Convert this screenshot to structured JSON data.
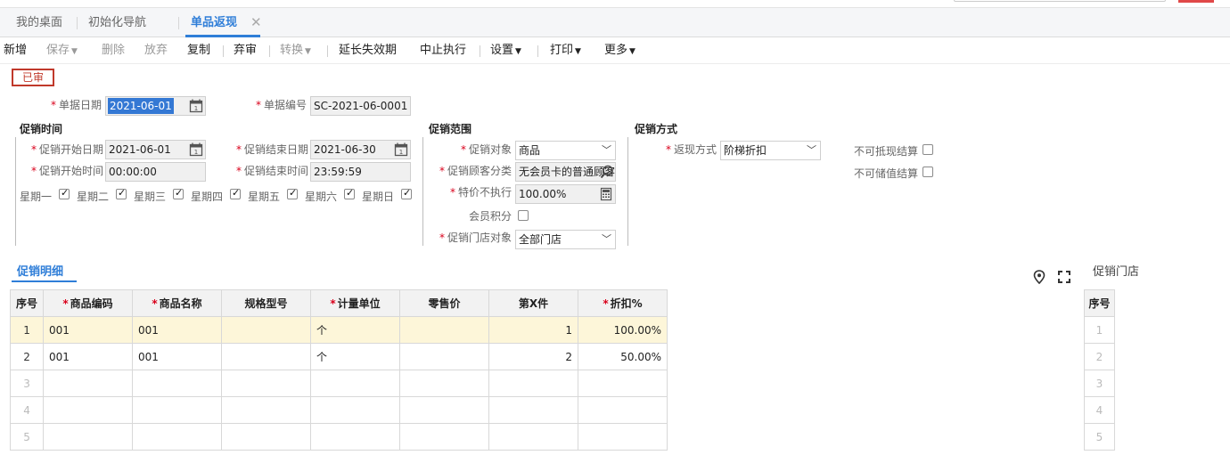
{
  "tabs": [
    {
      "label": "我的桌面"
    },
    {
      "label": "初始化导航"
    },
    {
      "label": "单品返现",
      "active": true
    }
  ],
  "tab_close_icon": "close-icon",
  "toolbar": {
    "new": "新增",
    "save": "保存",
    "delete": "删除",
    "discard": "放弃",
    "copy": "复制",
    "unaudit": "弃审",
    "convert": "转换",
    "extend": "延长失效期",
    "stop": "中止执行",
    "settings": "设置",
    "print": "打印",
    "more": "更多"
  },
  "status_stamp": "已审",
  "form": {
    "doc_date_label": "单据日期",
    "doc_date": "2021-06-01",
    "doc_no_label": "单据编号",
    "doc_no": "SC-2021-06-0001",
    "time_section": "促销时间",
    "start_date_label": "促销开始日期",
    "start_date": "2021-06-01",
    "end_date_label": "促销结束日期",
    "end_date": "2021-06-30",
    "start_time_label": "促销开始时间",
    "start_time": "00:00:00",
    "end_time_label": "促销结束时间",
    "end_time": "23:59:59",
    "weekdays": [
      {
        "label": "星期一",
        "checked": true
      },
      {
        "label": "星期二",
        "checked": true
      },
      {
        "label": "星期三",
        "checked": true
      },
      {
        "label": "星期四",
        "checked": true
      },
      {
        "label": "星期五",
        "checked": true
      },
      {
        "label": "星期六",
        "checked": true
      },
      {
        "label": "星期日",
        "checked": true
      }
    ],
    "scope_section": "促销范围",
    "target_label": "促销对象",
    "target_value": "商品",
    "customer_class_label": "促销顾客分类",
    "customer_class_value": "无会员卡的普通顾客",
    "special_price_label": "特价不执行",
    "special_price_value": "100.00%",
    "member_points_label": "会员积分",
    "member_points_checked": false,
    "store_target_label": "促销门店对象",
    "store_target_value": "全部门店",
    "method_section": "促销方式",
    "cashback_label": "返现方式",
    "cashback_value": "阶梯折扣",
    "no_offset_label": "不可抵现结算",
    "no_offset_checked": false,
    "no_stored_label": "不可储值结算",
    "no_stored_checked": false
  },
  "detail": {
    "tab_label": "促销明细",
    "columns": [
      "序号",
      "商品编码",
      "商品名称",
      "规格型号",
      "计量单位",
      "零售价",
      "第X件",
      "折扣%"
    ],
    "required_columns": [
      1,
      2,
      4,
      7
    ],
    "rows": [
      {
        "no": "1",
        "code": "001",
        "name": "001",
        "spec": "",
        "unit": "个",
        "price": "",
        "nth": "1",
        "discount": "100.00%"
      },
      {
        "no": "2",
        "code": "001",
        "name": "001",
        "spec": "",
        "unit": "个",
        "price": "",
        "nth": "2",
        "discount": "50.00%"
      },
      {
        "no": "3",
        "code": "",
        "name": "",
        "spec": "",
        "unit": "",
        "price": "",
        "nth": "",
        "discount": ""
      },
      {
        "no": "4",
        "code": "",
        "name": "",
        "spec": "",
        "unit": "",
        "price": "",
        "nth": "",
        "discount": ""
      },
      {
        "no": "5",
        "code": "",
        "name": "",
        "spec": "",
        "unit": "",
        "price": "",
        "nth": "",
        "discount": ""
      }
    ]
  },
  "stores": {
    "title": "促销门店",
    "column": "序号",
    "rows": [
      "1",
      "2",
      "3",
      "4",
      "5"
    ]
  },
  "icons": {
    "calendar": "calendar-icon",
    "search": "search-icon",
    "calculator": "calculator-icon",
    "location": "location-pin-icon",
    "fullscreen": "fullscreen-icon"
  },
  "colors": {
    "accent": "#2f7ed8",
    "required": "#d9001b",
    "stamp": "#c0392b",
    "selected_row": "#fdf6d9"
  }
}
